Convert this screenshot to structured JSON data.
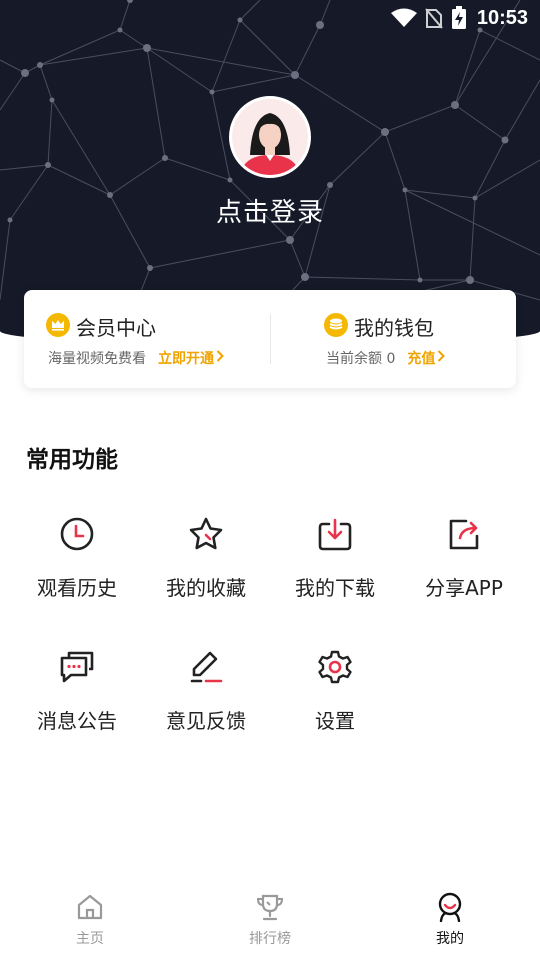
{
  "status_bar": {
    "time": "10:53",
    "icons": [
      "wifi-icon",
      "no-sim-icon",
      "battery-charging-icon"
    ]
  },
  "profile": {
    "avatar_icon": "avatar-girl-icon",
    "login_text": "点击登录"
  },
  "vip_card": {
    "icon": "crown-icon",
    "title": "会员中心",
    "subtitle": "海量视频免费看",
    "action": "立即开通"
  },
  "wallet_card": {
    "icon": "coin-icon",
    "title": "我的钱包",
    "subtitle": "当前余额 0",
    "action": "充值"
  },
  "features": {
    "title": "常用功能",
    "items": [
      {
        "label": "观看历史",
        "icon": "clock-icon"
      },
      {
        "label": "我的收藏",
        "icon": "star-icon"
      },
      {
        "label": "我的下载",
        "icon": "download-icon"
      },
      {
        "label": "分享APP",
        "icon": "share-icon"
      },
      {
        "label": "消息公告",
        "icon": "message-icon"
      },
      {
        "label": "意见反馈",
        "icon": "edit-icon"
      },
      {
        "label": "设置",
        "icon": "gear-icon"
      }
    ]
  },
  "tabbar": {
    "tabs": [
      {
        "label": "主页",
        "icon": "home-icon",
        "active": false
      },
      {
        "label": "排行榜",
        "icon": "trophy-icon",
        "active": false
      },
      {
        "label": "我的",
        "icon": "profile-icon",
        "active": true
      }
    ]
  },
  "colors": {
    "header_bg": "#161a28",
    "accent_red": "#e8334a",
    "gold": "#f0a400",
    "text_dark": "#222222",
    "tab_inactive": "#999999"
  }
}
